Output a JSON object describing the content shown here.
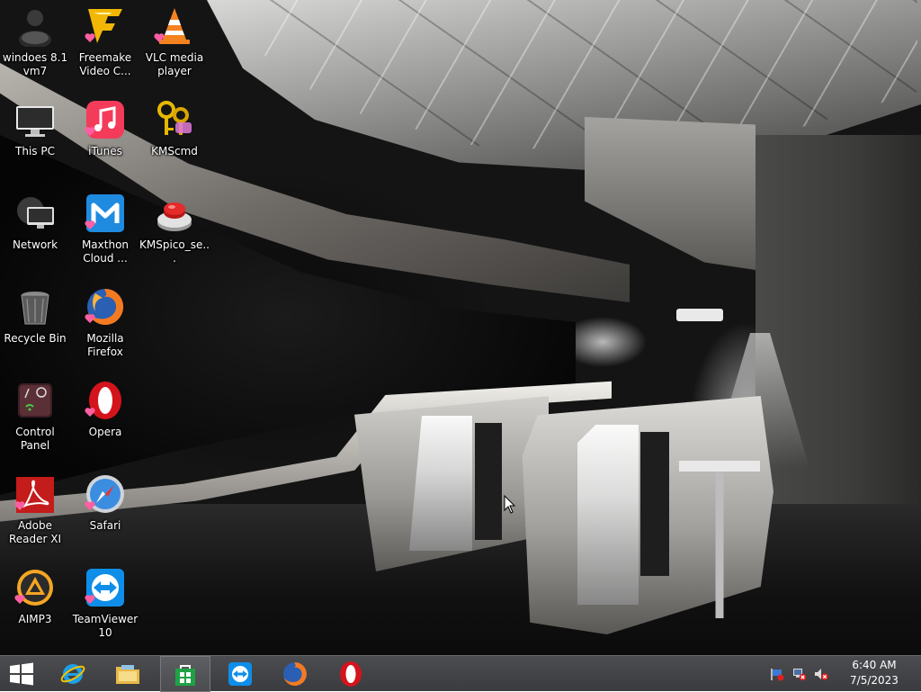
{
  "desktop": {
    "icons": [
      {
        "label": "windoes 8.1 vm7",
        "icon": "user-avatar-icon"
      },
      {
        "label": "This PC",
        "icon": "computer-monitor-icon"
      },
      {
        "label": "Network",
        "icon": "network-icon"
      },
      {
        "label": "Recycle Bin",
        "icon": "recycle-bin-icon"
      },
      {
        "label": "Control Panel",
        "icon": "control-panel-icon"
      },
      {
        "label": "Adobe Reader XI",
        "icon": "adobe-reader-icon"
      },
      {
        "label": "AIMP3",
        "icon": "aimp-icon"
      },
      {
        "label": "Freemake Video C...",
        "icon": "freemake-icon"
      },
      {
        "label": "iTunes",
        "icon": "itunes-icon"
      },
      {
        "label": "Maxthon Cloud ...",
        "icon": "maxthon-icon"
      },
      {
        "label": "Mozilla Firefox",
        "icon": "firefox-icon"
      },
      {
        "label": "Opera",
        "icon": "opera-icon"
      },
      {
        "label": "Safari",
        "icon": "safari-icon"
      },
      {
        "label": "TeamViewer 10",
        "icon": "teamviewer-icon"
      },
      {
        "label": "VLC media player",
        "icon": "vlc-icon"
      },
      {
        "label": "KMScmd",
        "icon": "keys-icon"
      },
      {
        "label": "KMSpico_se...",
        "icon": "red-button-icon"
      }
    ]
  },
  "taskbar": {
    "start": {
      "icon": "windows-start-icon"
    },
    "pinned": [
      {
        "name": "Internet Explorer",
        "icon": "internet-explorer-icon"
      },
      {
        "name": "File Explorer",
        "icon": "file-explorer-icon"
      },
      {
        "name": "Store",
        "icon": "store-icon",
        "active": true
      },
      {
        "name": "TeamViewer",
        "icon": "teamviewer-icon"
      },
      {
        "name": "Mozilla Firefox",
        "icon": "firefox-icon"
      },
      {
        "name": "Opera",
        "icon": "opera-icon"
      }
    ],
    "tray": [
      {
        "icon": "action-center-flag-icon"
      },
      {
        "icon": "network-disconnected-icon"
      },
      {
        "icon": "volume-muted-icon"
      }
    ],
    "clock": {
      "time": "6:40 AM",
      "date": "7/5/2023"
    }
  },
  "colors": {
    "taskbar": "#3f4043",
    "label_text": "#ffffff"
  }
}
